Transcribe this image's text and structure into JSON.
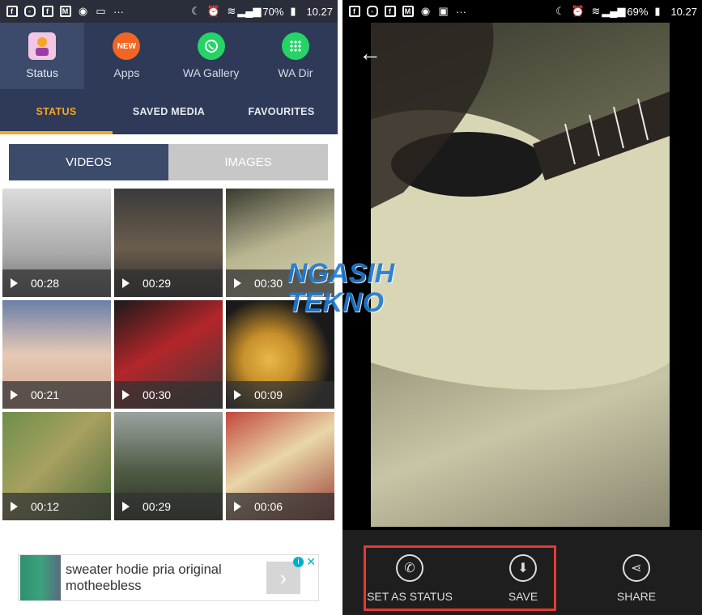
{
  "left_status": {
    "battery": "70%",
    "time": "10.27"
  },
  "right_status": {
    "battery": "69%",
    "time": "10.27"
  },
  "app_tabs": [
    {
      "label": "Status",
      "icon": "status-person-icon",
      "active": true
    },
    {
      "label": "Apps",
      "icon": "new-badge-icon",
      "badge": "NEW"
    },
    {
      "label": "WA Gallery",
      "icon": "whatsapp-icon"
    },
    {
      "label": "WA Dir",
      "icon": "dialpad-icon"
    }
  ],
  "sub_tabs": [
    {
      "label": "STATUS",
      "active": true
    },
    {
      "label": "SAVED MEDIA"
    },
    {
      "label": "FAVOURITES"
    }
  ],
  "media_toggle": {
    "videos": "VIDEOS",
    "images": "IMAGES",
    "selected": "VIDEOS"
  },
  "videos": [
    {
      "duration": "00:28"
    },
    {
      "duration": "00:29"
    },
    {
      "duration": "00:30"
    },
    {
      "duration": "00:21"
    },
    {
      "duration": "00:30"
    },
    {
      "duration": "00:09"
    },
    {
      "duration": "00:12"
    },
    {
      "duration": "00:29"
    },
    {
      "duration": "00:06"
    }
  ],
  "ad": {
    "text": "sweater hodie pria original motheebless",
    "info": "i",
    "close": "✕"
  },
  "viewer_actions": [
    {
      "label": "SET AS STATUS",
      "icon": "whatsapp-icon"
    },
    {
      "label": "SAVE",
      "icon": "download-icon"
    },
    {
      "label": "SHARE",
      "icon": "share-icon"
    }
  ],
  "watermark": {
    "line1": "NGASIH",
    "line2": "TEKNO"
  },
  "colors": {
    "header": "#2e3a57",
    "accent": "#f5a623",
    "highlight": "#e53935"
  }
}
